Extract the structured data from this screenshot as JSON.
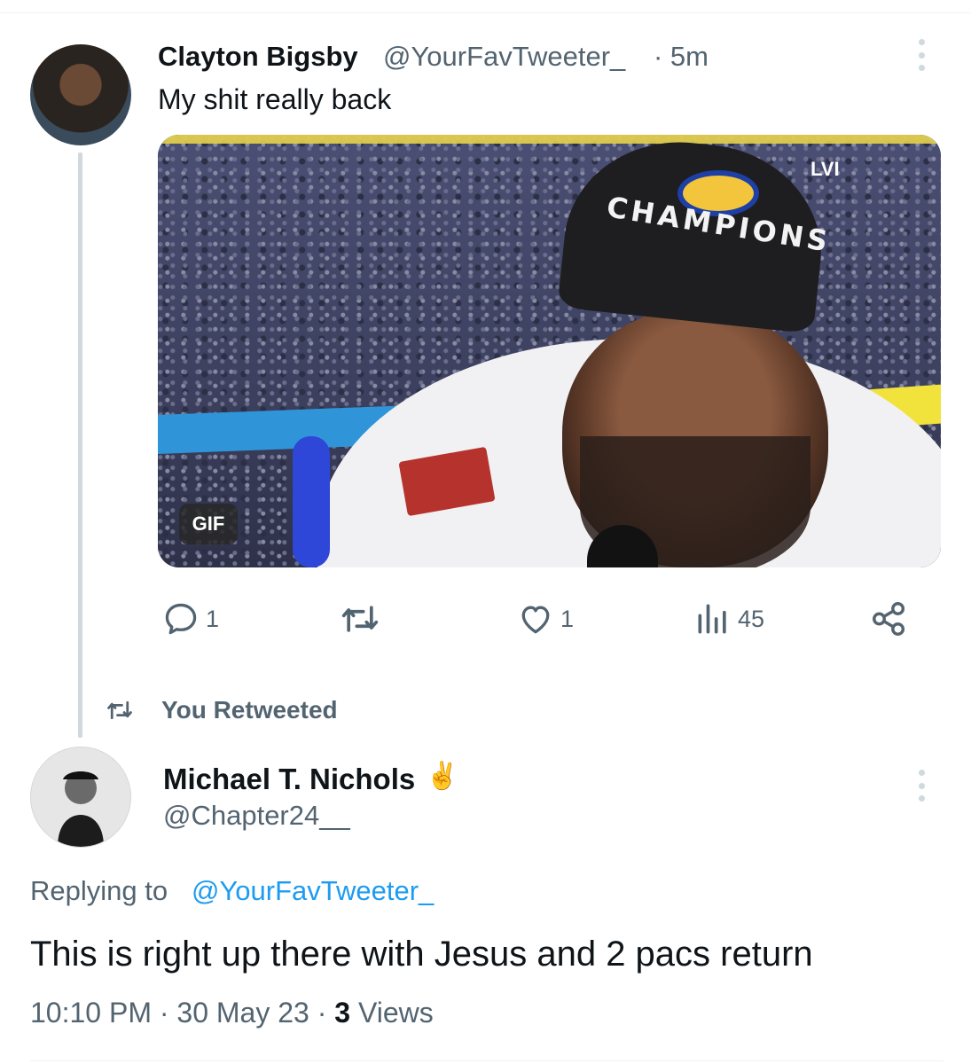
{
  "tweet": {
    "author_name": "Clayton Bigsby",
    "author_handle": "@YourFavTweeter_",
    "time": "· 5m",
    "text": "My shit really back",
    "media": {
      "badge": "GIF",
      "cap_text": "CHAMPIONS",
      "network_mark": "LVI"
    },
    "actions": {
      "replies": "1",
      "retweets": "",
      "likes": "1",
      "views": "45"
    }
  },
  "retweet_notice": "You Retweeted",
  "reply": {
    "author_name": "Michael T. Nichols",
    "author_emoji": "✌️",
    "author_handle": "@Chapter24__",
    "replying_prefix": "Replying to",
    "replying_handle": "@YourFavTweeter_",
    "text": "This is right up there with Jesus and 2 pacs return",
    "time": "10:10 PM",
    "date": "30 May 23",
    "views_count": "3",
    "views_label": "Views"
  },
  "colors": {
    "text": "#0f1419",
    "secondary": "#536471",
    "link": "#1d9bf0",
    "thread_line": "#cfd9de"
  }
}
